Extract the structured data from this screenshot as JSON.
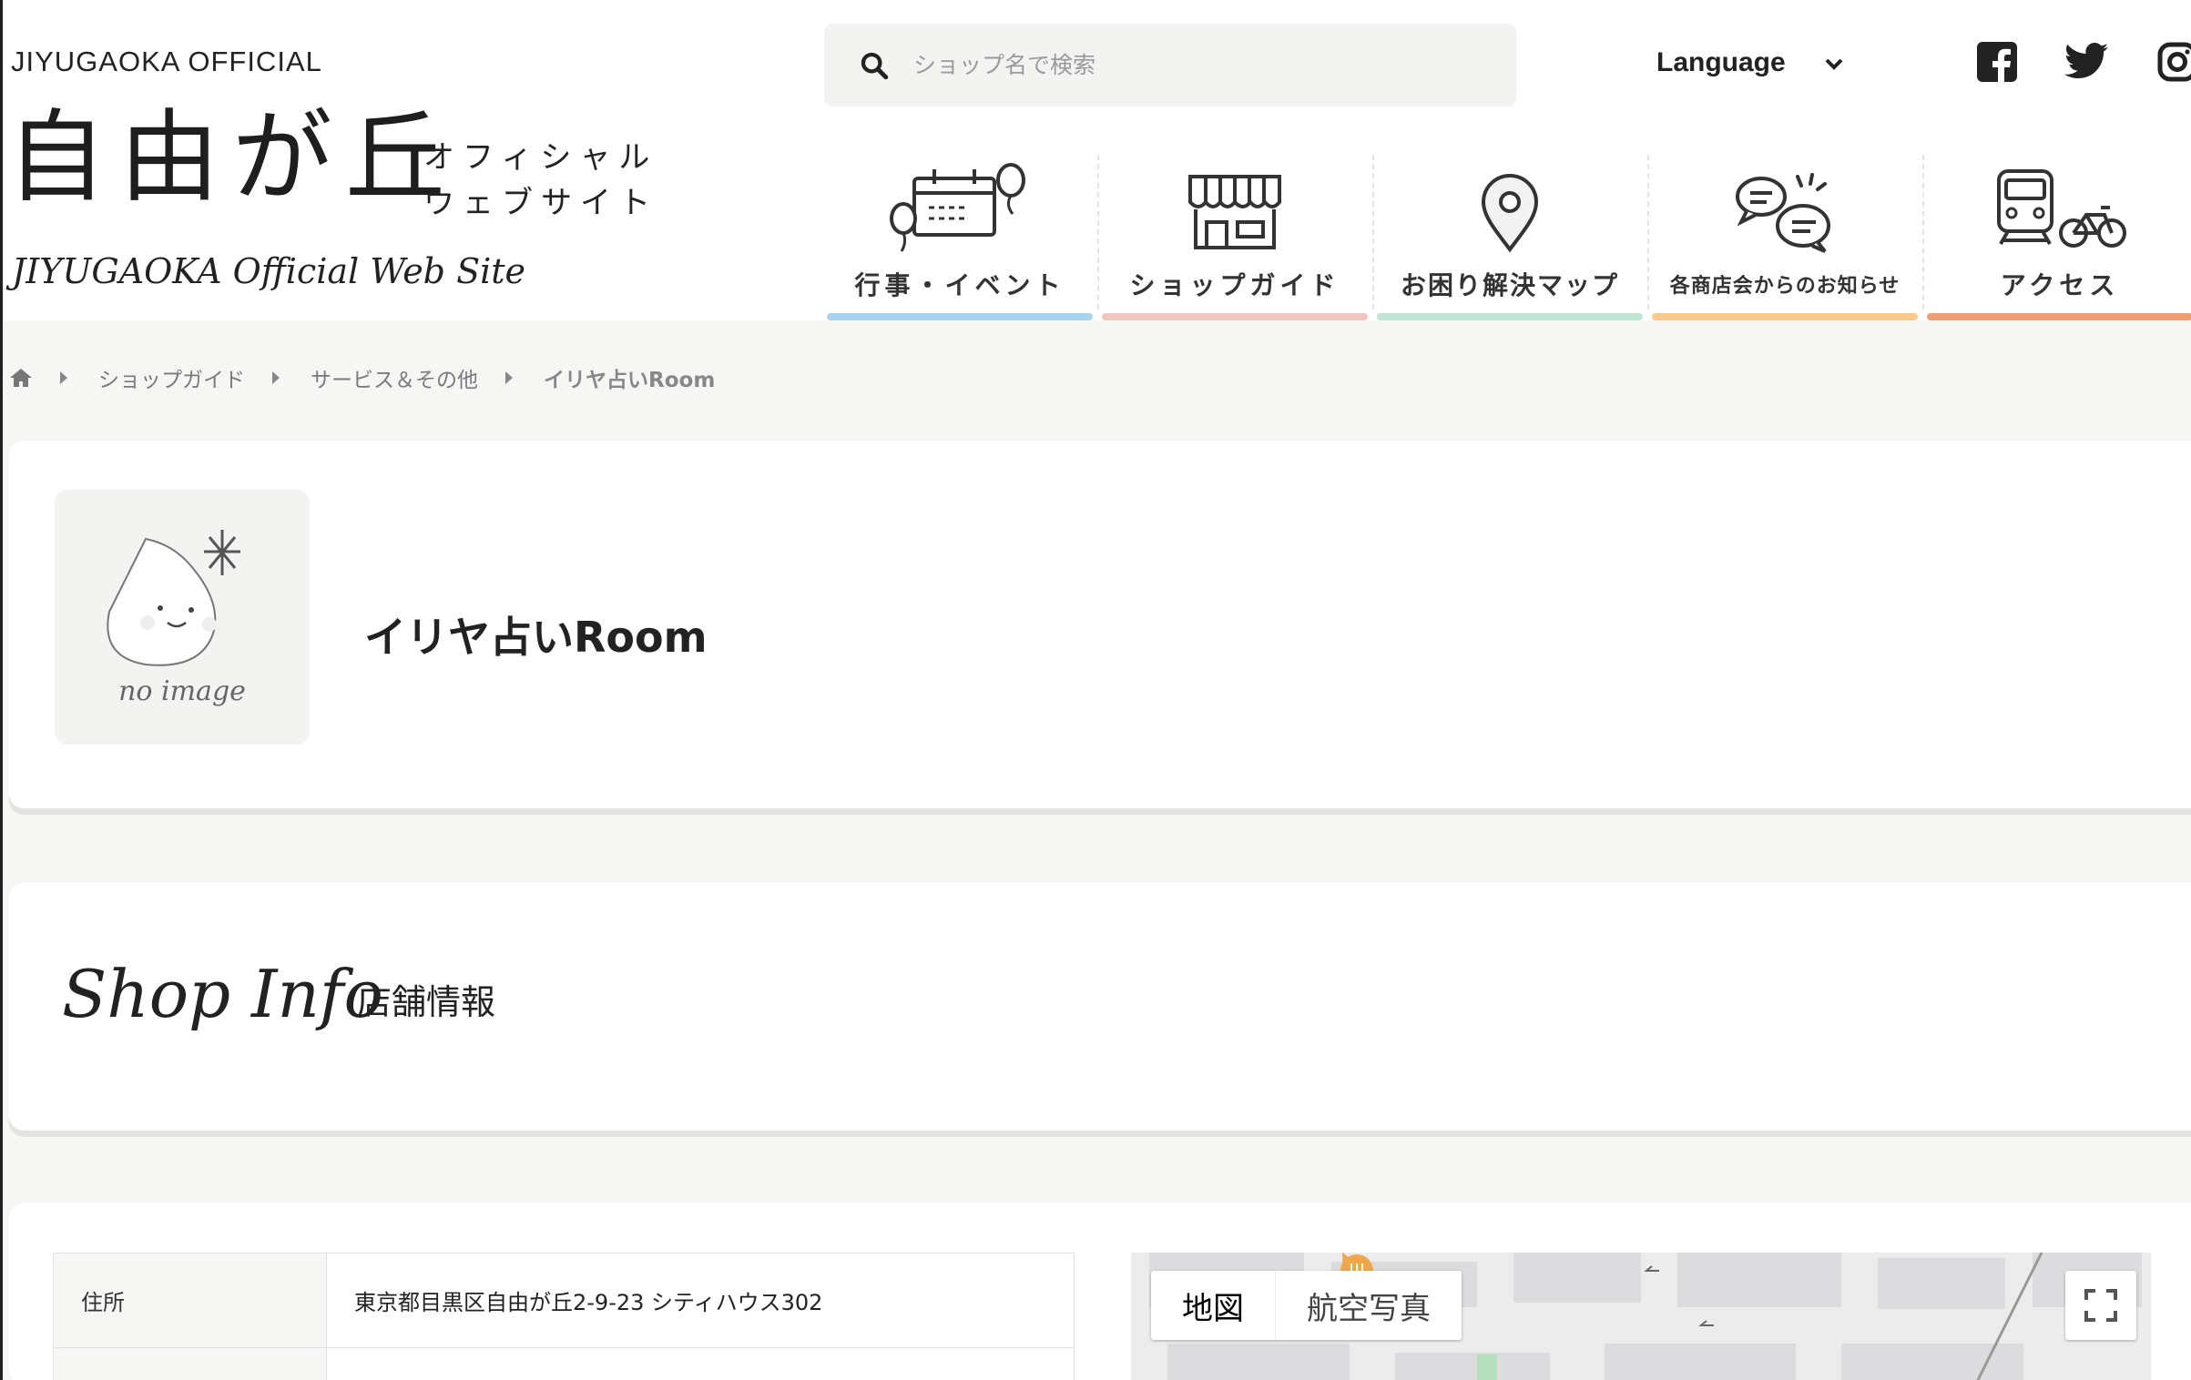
{
  "header": {
    "brand_small": "JIYUGAOKA OFFICIAL",
    "logo_kanji": "自由が丘",
    "logo_sub_line1": "オフィシャル",
    "logo_sub_line2": "ウェブサイト",
    "logo_script": "JIYUGAOKA Official Web Site",
    "search_placeholder": "ショップ名で検索",
    "language_label": "Language"
  },
  "nav": {
    "items": [
      {
        "label": "行事・イベント",
        "icon": "calendar-balloons-icon",
        "color": "#a9d3ef"
      },
      {
        "label": "ショップガイド",
        "icon": "storefront-icon",
        "color": "#f2c6c0"
      },
      {
        "label": "お困り解決マップ",
        "icon": "map-pin-icon",
        "color": "#bfe6d5"
      },
      {
        "label": "各商店会からのお知らせ",
        "icon": "speech-bubbles-icon",
        "color": "#f7c98a"
      },
      {
        "label": "アクセス",
        "icon": "train-bicycle-icon",
        "color": "#ee9f72"
      }
    ]
  },
  "breadcrumb": {
    "items": [
      "ショップガイド",
      "サービス＆その他",
      "イリヤ占いRoom"
    ]
  },
  "shop": {
    "no_image_label": "no image",
    "title": "イリヤ占いRoom"
  },
  "shop_info": {
    "script_title": "Shop Info",
    "jp_title": "店舗情報",
    "rows": [
      {
        "key": "住所",
        "value": "東京都目黒区自由が丘2-9-23 シティハウス302"
      }
    ]
  },
  "map": {
    "tab_map": "地図",
    "tab_satellite": "航空写真"
  }
}
